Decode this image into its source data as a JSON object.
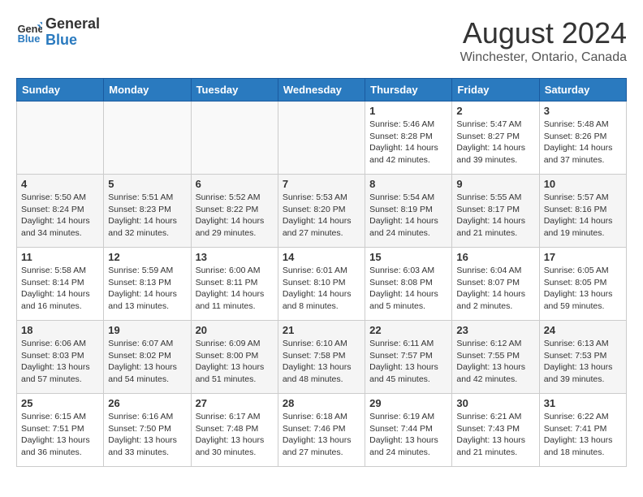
{
  "header": {
    "logo_general": "General",
    "logo_blue": "Blue",
    "month_year": "August 2024",
    "location": "Winchester, Ontario, Canada"
  },
  "days_of_week": [
    "Sunday",
    "Monday",
    "Tuesday",
    "Wednesday",
    "Thursday",
    "Friday",
    "Saturday"
  ],
  "weeks": [
    [
      {
        "day": "",
        "info": ""
      },
      {
        "day": "",
        "info": ""
      },
      {
        "day": "",
        "info": ""
      },
      {
        "day": "",
        "info": ""
      },
      {
        "day": "1",
        "info": "Sunrise: 5:46 AM\nSunset: 8:28 PM\nDaylight: 14 hours\nand 42 minutes."
      },
      {
        "day": "2",
        "info": "Sunrise: 5:47 AM\nSunset: 8:27 PM\nDaylight: 14 hours\nand 39 minutes."
      },
      {
        "day": "3",
        "info": "Sunrise: 5:48 AM\nSunset: 8:26 PM\nDaylight: 14 hours\nand 37 minutes."
      }
    ],
    [
      {
        "day": "4",
        "info": "Sunrise: 5:50 AM\nSunset: 8:24 PM\nDaylight: 14 hours\nand 34 minutes."
      },
      {
        "day": "5",
        "info": "Sunrise: 5:51 AM\nSunset: 8:23 PM\nDaylight: 14 hours\nand 32 minutes."
      },
      {
        "day": "6",
        "info": "Sunrise: 5:52 AM\nSunset: 8:22 PM\nDaylight: 14 hours\nand 29 minutes."
      },
      {
        "day": "7",
        "info": "Sunrise: 5:53 AM\nSunset: 8:20 PM\nDaylight: 14 hours\nand 27 minutes."
      },
      {
        "day": "8",
        "info": "Sunrise: 5:54 AM\nSunset: 8:19 PM\nDaylight: 14 hours\nand 24 minutes."
      },
      {
        "day": "9",
        "info": "Sunrise: 5:55 AM\nSunset: 8:17 PM\nDaylight: 14 hours\nand 21 minutes."
      },
      {
        "day": "10",
        "info": "Sunrise: 5:57 AM\nSunset: 8:16 PM\nDaylight: 14 hours\nand 19 minutes."
      }
    ],
    [
      {
        "day": "11",
        "info": "Sunrise: 5:58 AM\nSunset: 8:14 PM\nDaylight: 14 hours\nand 16 minutes."
      },
      {
        "day": "12",
        "info": "Sunrise: 5:59 AM\nSunset: 8:13 PM\nDaylight: 14 hours\nand 13 minutes."
      },
      {
        "day": "13",
        "info": "Sunrise: 6:00 AM\nSunset: 8:11 PM\nDaylight: 14 hours\nand 11 minutes."
      },
      {
        "day": "14",
        "info": "Sunrise: 6:01 AM\nSunset: 8:10 PM\nDaylight: 14 hours\nand 8 minutes."
      },
      {
        "day": "15",
        "info": "Sunrise: 6:03 AM\nSunset: 8:08 PM\nDaylight: 14 hours\nand 5 minutes."
      },
      {
        "day": "16",
        "info": "Sunrise: 6:04 AM\nSunset: 8:07 PM\nDaylight: 14 hours\nand 2 minutes."
      },
      {
        "day": "17",
        "info": "Sunrise: 6:05 AM\nSunset: 8:05 PM\nDaylight: 13 hours\nand 59 minutes."
      }
    ],
    [
      {
        "day": "18",
        "info": "Sunrise: 6:06 AM\nSunset: 8:03 PM\nDaylight: 13 hours\nand 57 minutes."
      },
      {
        "day": "19",
        "info": "Sunrise: 6:07 AM\nSunset: 8:02 PM\nDaylight: 13 hours\nand 54 minutes."
      },
      {
        "day": "20",
        "info": "Sunrise: 6:09 AM\nSunset: 8:00 PM\nDaylight: 13 hours\nand 51 minutes."
      },
      {
        "day": "21",
        "info": "Sunrise: 6:10 AM\nSunset: 7:58 PM\nDaylight: 13 hours\nand 48 minutes."
      },
      {
        "day": "22",
        "info": "Sunrise: 6:11 AM\nSunset: 7:57 PM\nDaylight: 13 hours\nand 45 minutes."
      },
      {
        "day": "23",
        "info": "Sunrise: 6:12 AM\nSunset: 7:55 PM\nDaylight: 13 hours\nand 42 minutes."
      },
      {
        "day": "24",
        "info": "Sunrise: 6:13 AM\nSunset: 7:53 PM\nDaylight: 13 hours\nand 39 minutes."
      }
    ],
    [
      {
        "day": "25",
        "info": "Sunrise: 6:15 AM\nSunset: 7:51 PM\nDaylight: 13 hours\nand 36 minutes."
      },
      {
        "day": "26",
        "info": "Sunrise: 6:16 AM\nSunset: 7:50 PM\nDaylight: 13 hours\nand 33 minutes."
      },
      {
        "day": "27",
        "info": "Sunrise: 6:17 AM\nSunset: 7:48 PM\nDaylight: 13 hours\nand 30 minutes."
      },
      {
        "day": "28",
        "info": "Sunrise: 6:18 AM\nSunset: 7:46 PM\nDaylight: 13 hours\nand 27 minutes."
      },
      {
        "day": "29",
        "info": "Sunrise: 6:19 AM\nSunset: 7:44 PM\nDaylight: 13 hours\nand 24 minutes."
      },
      {
        "day": "30",
        "info": "Sunrise: 6:21 AM\nSunset: 7:43 PM\nDaylight: 13 hours\nand 21 minutes."
      },
      {
        "day": "31",
        "info": "Sunrise: 6:22 AM\nSunset: 7:41 PM\nDaylight: 13 hours\nand 18 minutes."
      }
    ]
  ]
}
